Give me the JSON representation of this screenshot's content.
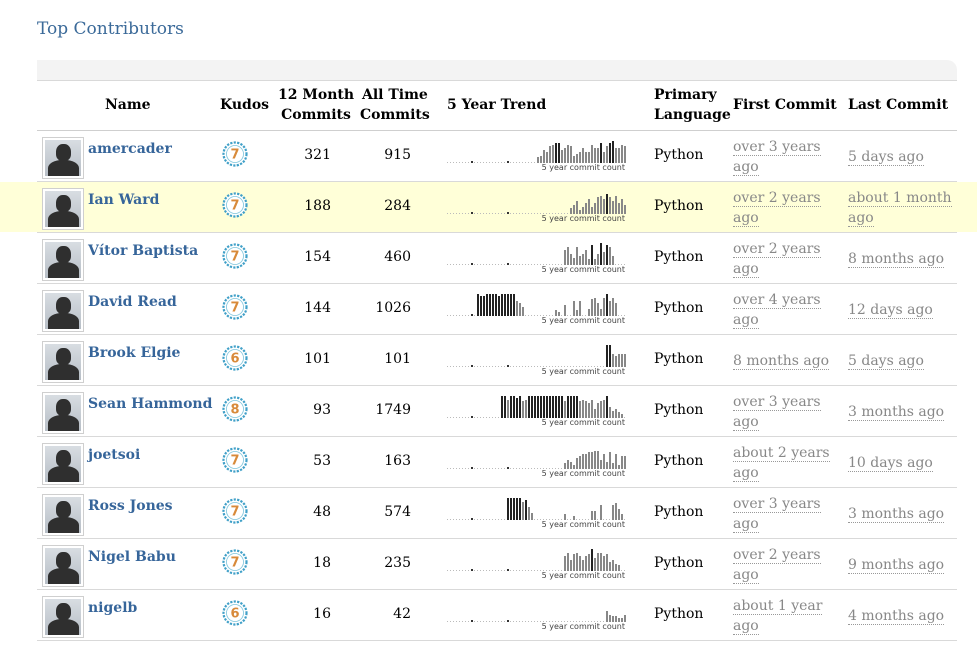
{
  "page": {
    "title": "Top Contributors"
  },
  "headers": {
    "name": "Name",
    "kudos": "Kudos",
    "m12_line1": "12 Month",
    "m12_line2": "Commits",
    "all_line1": "All Time",
    "all_line2": "Commits",
    "trend": "5 Year Trend",
    "lang_line1": "Primary",
    "lang_line2": "Language",
    "first": "First Commit",
    "last": "Last Commit"
  },
  "trend_caption": "5 year commit count",
  "colors": {
    "link": "#36659a",
    "highlight": "#ffffd8",
    "kudos_ring": "#40a0c8",
    "kudos_number": "#d88a3a"
  },
  "contributors": [
    {
      "name": "amercader",
      "kudos": "7",
      "m12": "321",
      "all": "915",
      "lang": "Python",
      "first_a": "over 3 years",
      "first_b": "ago",
      "last_a": "5 days ago",
      "last_b": "",
      "trend": [
        0,
        0,
        0,
        0,
        0,
        0,
        0,
        0,
        0,
        0,
        0,
        0,
        0,
        0,
        0,
        0,
        0,
        0,
        0,
        0,
        0,
        0,
        0,
        0,
        0,
        0,
        0,
        0,
        0,
        0,
        3,
        4,
        7,
        6,
        9,
        10,
        11,
        11,
        7,
        8,
        10,
        9,
        4,
        5,
        6,
        8,
        6,
        6,
        10,
        8,
        8,
        11,
        6,
        9,
        11,
        12,
        8,
        8,
        10,
        9
      ]
    },
    {
      "name": "Ian Ward",
      "kudos": "7",
      "m12": "188",
      "all": "284",
      "lang": "Python",
      "first_a": "over 2 years",
      "first_b": "ago",
      "last_a": "about 1 month",
      "last_b": "ago",
      "highlight": true,
      "trend": [
        0,
        0,
        0,
        0,
        0,
        0,
        0,
        0,
        0,
        0,
        0,
        0,
        0,
        0,
        0,
        0,
        0,
        0,
        0,
        0,
        0,
        0,
        0,
        0,
        0,
        0,
        0,
        0,
        0,
        0,
        0,
        0,
        0,
        0,
        0,
        0,
        0,
        0,
        0,
        0,
        0,
        3,
        5,
        7,
        2,
        4,
        6,
        8,
        4,
        6,
        9,
        10,
        8,
        11,
        9,
        7,
        10,
        6,
        8,
        5
      ]
    },
    {
      "name": "Vítor Baptista",
      "kudos": "7",
      "m12": "154",
      "all": "460",
      "lang": "Python",
      "first_a": "over 2 years",
      "first_b": "ago",
      "last_a": "8 months ago",
      "last_b": "",
      "trend": [
        0,
        0,
        0,
        0,
        0,
        0,
        0,
        0,
        0,
        0,
        0,
        0,
        0,
        0,
        0,
        0,
        0,
        0,
        0,
        0,
        0,
        0,
        0,
        0,
        0,
        0,
        0,
        0,
        0,
        0,
        0,
        0,
        0,
        0,
        0,
        0,
        0,
        0,
        0,
        8,
        10,
        6,
        4,
        10,
        5,
        6,
        8,
        3,
        11,
        3,
        6,
        12,
        7,
        11,
        10,
        5,
        0,
        0,
        0,
        0
      ]
    },
    {
      "name": "David Read",
      "kudos": "7",
      "m12": "144",
      "all": "1026",
      "lang": "Python",
      "first_a": "over 4 years",
      "first_b": "ago",
      "last_a": "12 days ago",
      "last_b": "",
      "trend": [
        0,
        0,
        0,
        0,
        0,
        0,
        0,
        0,
        0,
        0,
        12,
        11,
        11,
        12,
        12,
        12,
        12,
        11,
        12,
        12,
        12,
        12,
        12,
        8,
        7,
        5,
        0,
        0,
        0,
        0,
        0,
        0,
        0,
        0,
        0,
        0,
        3,
        2,
        0,
        6,
        0,
        0,
        8,
        3,
        8,
        0,
        0,
        4,
        9,
        10,
        7,
        4,
        10,
        12,
        8,
        10,
        7,
        0,
        0,
        0
      ]
    },
    {
      "name": "Brook Elgie",
      "kudos": "6",
      "m12": "101",
      "all": "101",
      "lang": "Python",
      "first_a": "8 months ago",
      "first_b": "",
      "last_a": "5 days ago",
      "last_b": "",
      "trend": [
        0,
        0,
        0,
        0,
        0,
        0,
        0,
        0,
        0,
        0,
        0,
        0,
        0,
        0,
        0,
        0,
        0,
        0,
        0,
        0,
        0,
        0,
        0,
        0,
        0,
        0,
        0,
        0,
        0,
        0,
        0,
        0,
        0,
        0,
        0,
        0,
        0,
        0,
        0,
        0,
        0,
        0,
        0,
        0,
        0,
        0,
        0,
        0,
        0,
        0,
        0,
        0,
        0,
        12,
        12,
        7,
        6,
        7,
        7,
        7
      ]
    },
    {
      "name": "Sean Hammond",
      "kudos": "8",
      "m12": "93",
      "all": "1749",
      "lang": "Python",
      "first_a": "over 3 years",
      "first_b": "ago",
      "last_a": "3 months ago",
      "last_b": "",
      "trend": [
        0,
        0,
        0,
        0,
        0,
        0,
        0,
        0,
        0,
        0,
        0,
        0,
        0,
        0,
        0,
        0,
        0,
        0,
        12,
        12,
        10,
        12,
        12,
        11,
        12,
        9,
        10,
        12,
        12,
        12,
        12,
        12,
        12,
        12,
        12,
        12,
        12,
        12,
        12,
        9,
        12,
        12,
        12,
        12,
        9,
        10,
        9,
        8,
        10,
        5,
        8,
        9,
        10,
        12,
        6,
        4,
        5,
        3,
        2,
        0
      ]
    },
    {
      "name": "joetsoi",
      "kudos": "7",
      "m12": "53",
      "all": "163",
      "lang": "Python",
      "first_a": "about 2 years",
      "first_b": "ago",
      "last_a": "10 days ago",
      "last_b": "",
      "trend": [
        0,
        0,
        0,
        0,
        0,
        0,
        0,
        0,
        0,
        0,
        0,
        0,
        0,
        0,
        0,
        0,
        0,
        0,
        0,
        0,
        0,
        0,
        0,
        0,
        0,
        0,
        0,
        0,
        0,
        0,
        0,
        0,
        0,
        0,
        0,
        0,
        0,
        0,
        0,
        3,
        5,
        4,
        2,
        6,
        7,
        8,
        8,
        9,
        9,
        10,
        10,
        5,
        8,
        4,
        9,
        3,
        8,
        2,
        7,
        7
      ]
    },
    {
      "name": "Ross Jones",
      "kudos": "7",
      "m12": "48",
      "all": "574",
      "lang": "Python",
      "first_a": "over 3 years",
      "first_b": "ago",
      "last_a": "3 months ago",
      "last_b": "",
      "trend": [
        0,
        0,
        0,
        0,
        0,
        0,
        0,
        0,
        0,
        0,
        0,
        0,
        0,
        0,
        0,
        0,
        0,
        0,
        0,
        0,
        12,
        12,
        12,
        12,
        12,
        10,
        11,
        7,
        4,
        0,
        0,
        0,
        0,
        0,
        0,
        0,
        0,
        0,
        0,
        3,
        0,
        0,
        2,
        0,
        0,
        0,
        0,
        0,
        5,
        5,
        0,
        8,
        0,
        0,
        0,
        8,
        9,
        6,
        3,
        0
      ]
    },
    {
      "name": "Nigel Babu",
      "kudos": "7",
      "m12": "18",
      "all": "235",
      "lang": "Python",
      "first_a": "over 2 years",
      "first_b": "ago",
      "last_a": "9 months ago",
      "last_b": "",
      "trend": [
        0,
        0,
        0,
        0,
        0,
        0,
        0,
        0,
        0,
        0,
        0,
        0,
        0,
        0,
        0,
        0,
        0,
        0,
        0,
        0,
        0,
        0,
        0,
        0,
        0,
        0,
        0,
        0,
        0,
        0,
        0,
        0,
        0,
        0,
        0,
        0,
        0,
        0,
        0,
        8,
        10,
        6,
        9,
        10,
        8,
        6,
        8,
        9,
        12,
        7,
        10,
        10,
        8,
        9,
        5,
        6,
        4,
        3,
        0,
        0
      ]
    },
    {
      "name": "nigelb",
      "kudos": "6",
      "m12": "16",
      "all": "42",
      "lang": "Python",
      "first_a": "about 1 year",
      "first_b": "ago",
      "last_a": "4 months ago",
      "last_b": "",
      "trend": [
        0,
        0,
        0,
        0,
        0,
        0,
        0,
        0,
        0,
        0,
        0,
        0,
        0,
        0,
        0,
        0,
        0,
        0,
        0,
        0,
        0,
        0,
        0,
        0,
        0,
        0,
        0,
        0,
        0,
        0,
        0,
        0,
        0,
        0,
        0,
        0,
        0,
        0,
        0,
        0,
        0,
        0,
        0,
        0,
        0,
        0,
        0,
        0,
        0,
        0,
        0,
        0,
        0,
        6,
        4,
        3,
        3,
        2,
        2,
        4
      ]
    }
  ]
}
